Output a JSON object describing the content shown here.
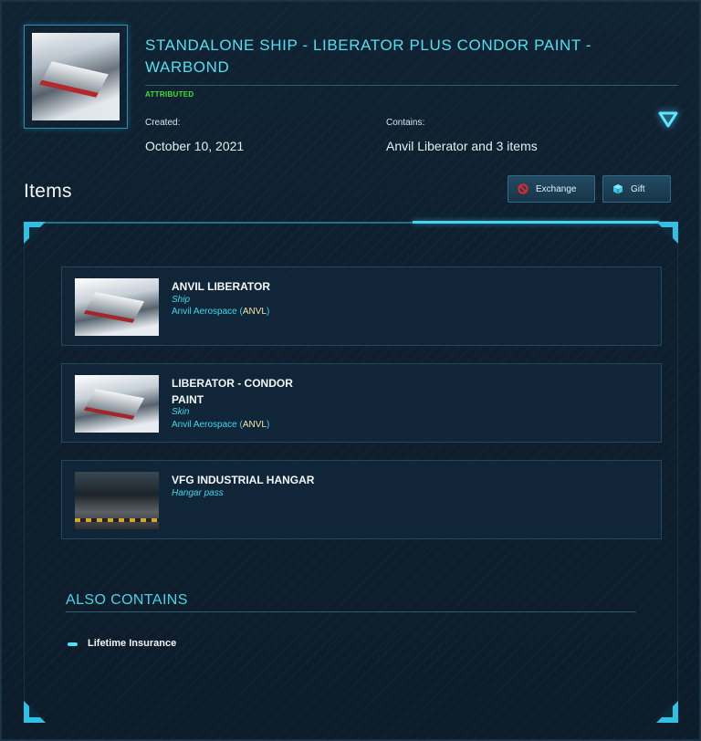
{
  "pledge": {
    "title": "STANDALONE SHIP - LIBERATOR PLUS CONDOR PAINT - WARBOND",
    "status": "ATTRIBUTED",
    "created_label": "Created:",
    "created_value": "October 10, 2021",
    "contains_label": "Contains:",
    "contains_value": "Anvil Liberator and 3 items"
  },
  "items_section": {
    "heading": "Items",
    "exchange_label": "Exchange",
    "gift_label": "Gift"
  },
  "items": [
    {
      "name": "ANVIL LIBERATOR",
      "type": "Ship",
      "maker": "Anvil Aerospace (",
      "maker_code": "ANVL",
      "maker_close": ")"
    },
    {
      "name": "LIBERATOR - CONDOR PAINT",
      "type": "Skin",
      "maker": "Anvil Aerospace (",
      "maker_code": "ANVL",
      "maker_close": ")"
    },
    {
      "name": "VFG INDUSTRIAL HANGAR",
      "type": "Hangar pass"
    }
  ],
  "also_contains": {
    "heading": "ALSO CONTAINS",
    "items": [
      "Lifetime Insurance"
    ]
  },
  "colors": {
    "accent": "#4fe0f2",
    "status_green": "#3ee03e",
    "background": "#0c1a26"
  },
  "icons": {
    "expand": "chevron-down-triangle-icon",
    "exchange": "prohibited-circle-icon",
    "gift": "cube-icon"
  }
}
